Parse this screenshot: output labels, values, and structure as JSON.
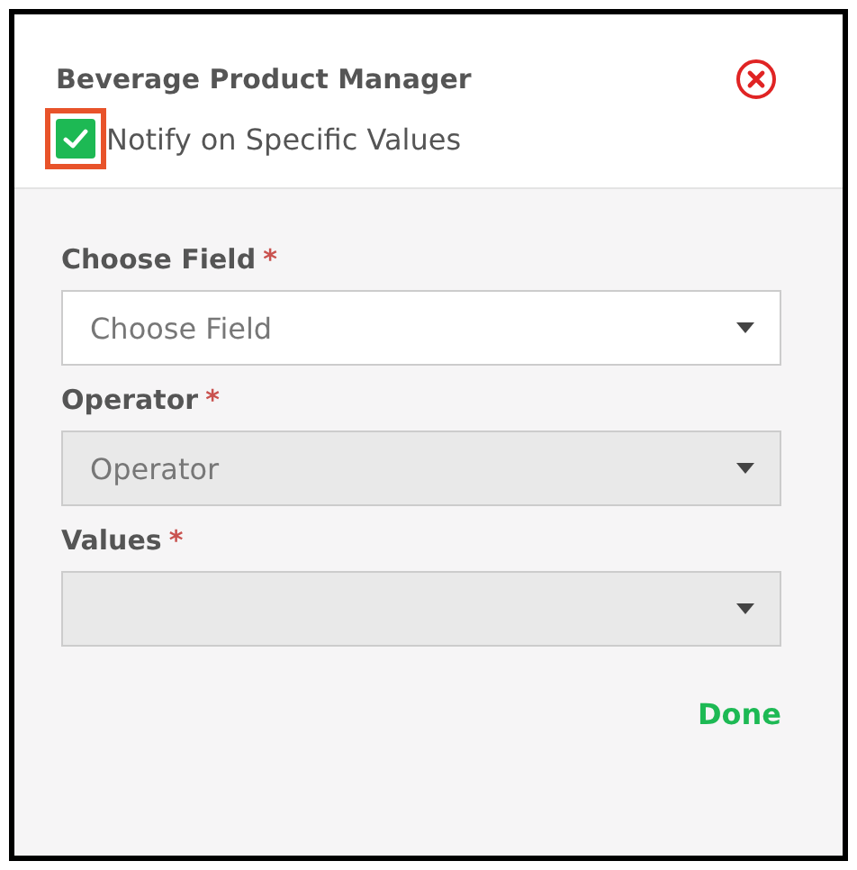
{
  "dialog": {
    "title": "Beverage Product Manager",
    "notify": {
      "label": "Notify on Specific Values",
      "checked": true,
      "highlighted": true
    }
  },
  "fields": [
    {
      "label": "Choose Field",
      "required_mark": "*",
      "placeholder": "Choose Field",
      "disabled": false
    },
    {
      "label": "Operator",
      "required_mark": "*",
      "placeholder": "Operator",
      "disabled": true
    },
    {
      "label": "Values",
      "required_mark": "*",
      "disabled": true
    }
  ],
  "done_button": "Done"
}
